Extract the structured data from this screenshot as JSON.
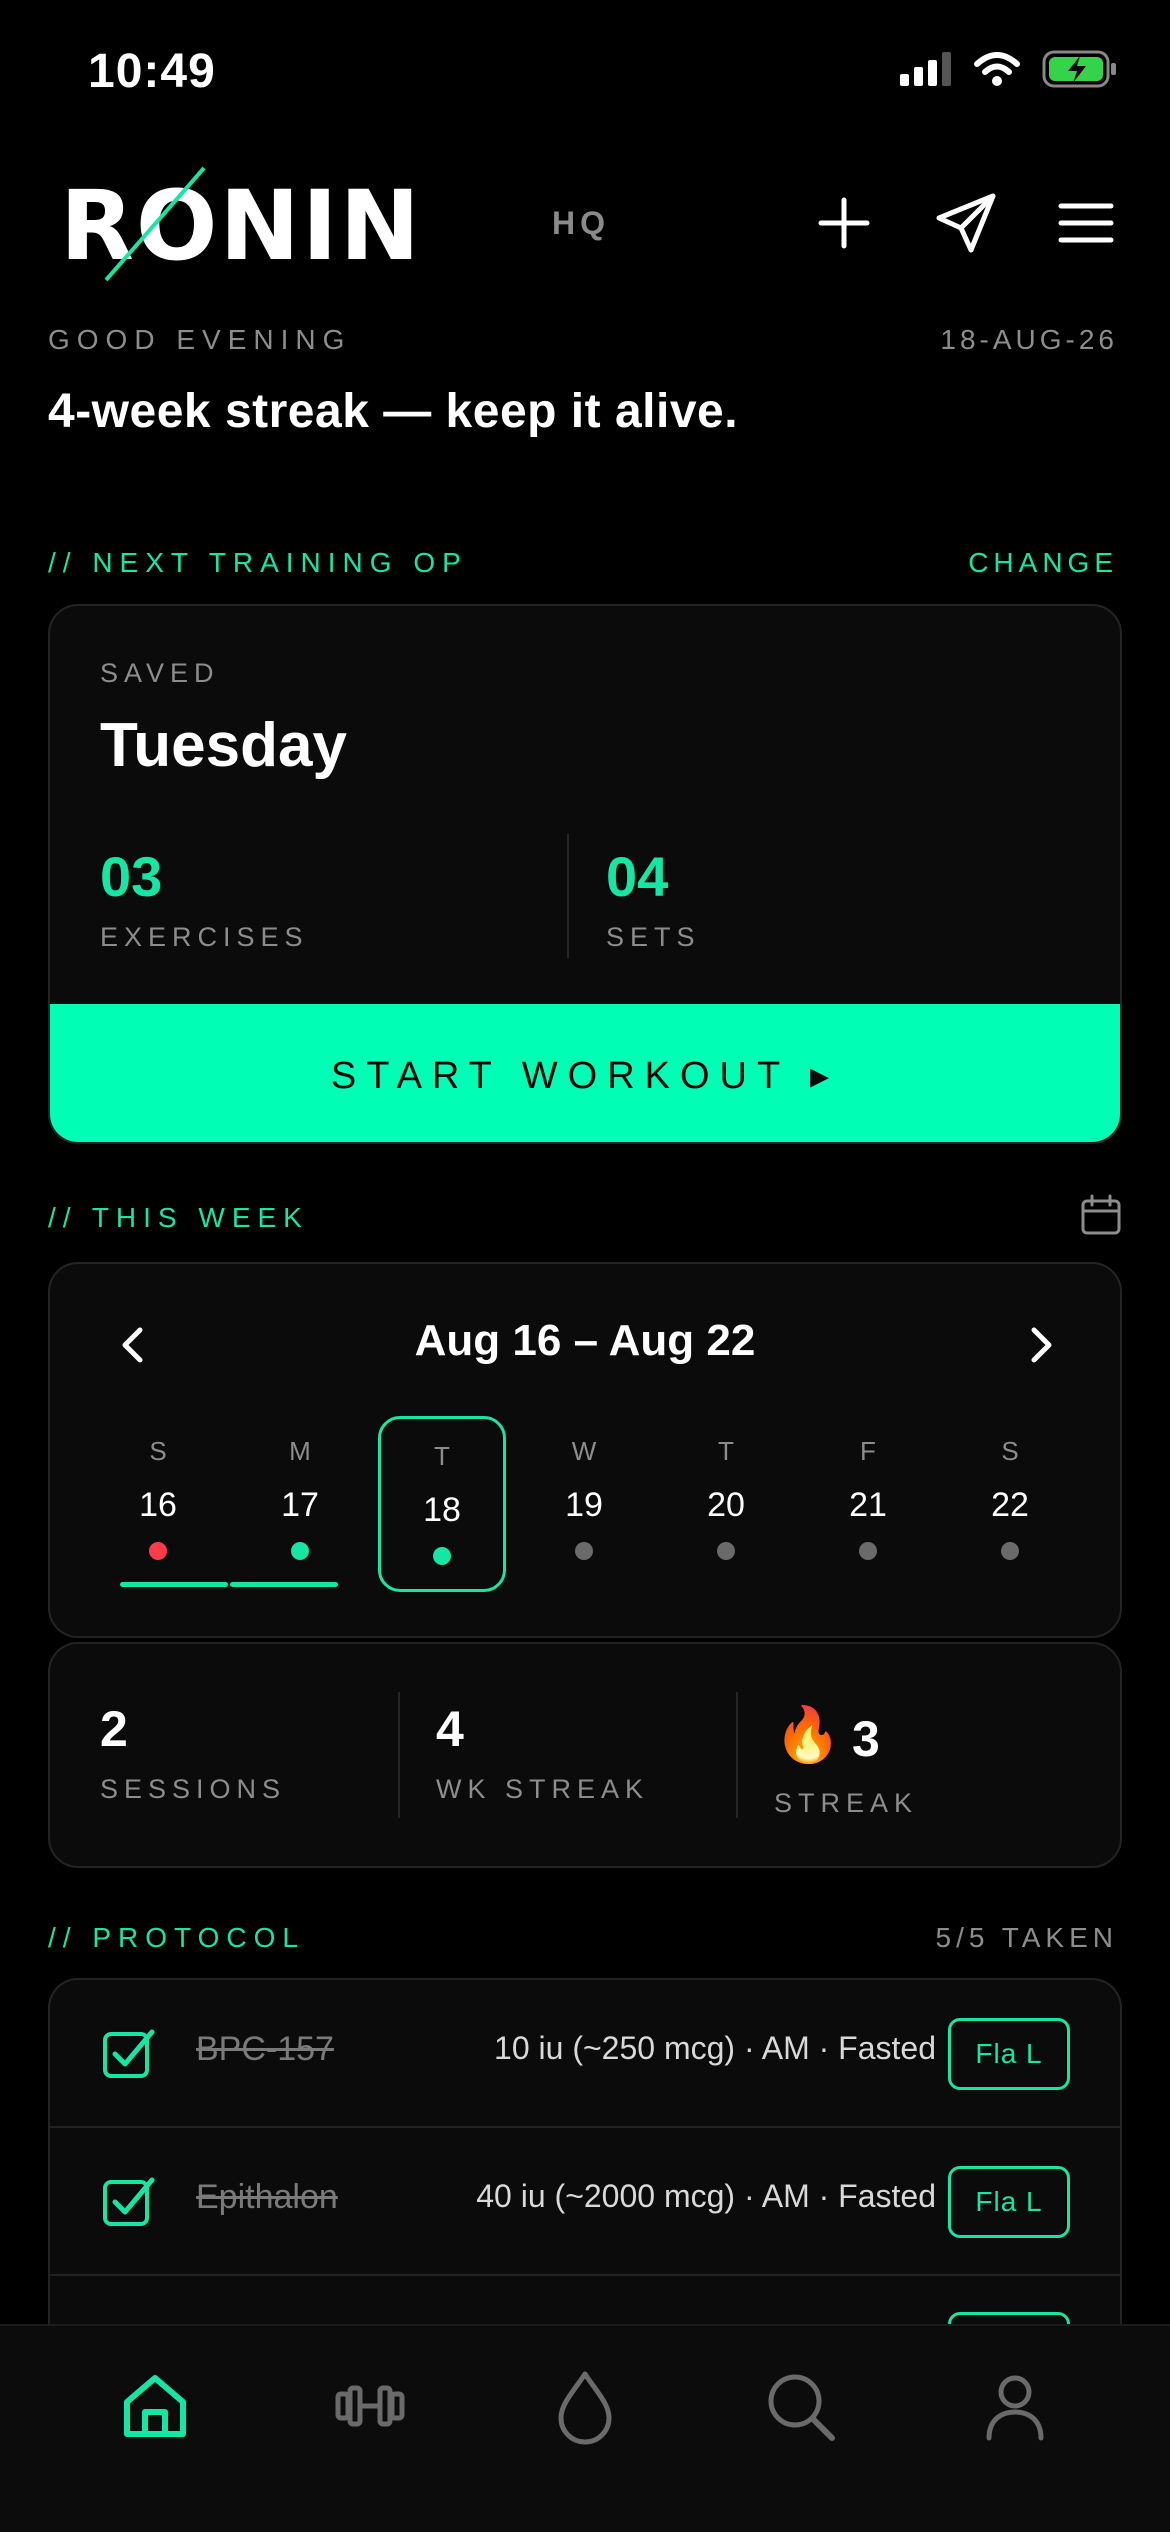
{
  "status": {
    "time": "10:49"
  },
  "header": {
    "logo": "RONIN",
    "center_label": "HQ",
    "icons": [
      "plus-icon",
      "send-icon",
      "menu-icon"
    ]
  },
  "greeting": {
    "label": "GOOD EVENING",
    "date": "18-AUG-26",
    "headline": "4-week streak — keep it alive."
  },
  "next_training": {
    "section_label": "// NEXT TRAINING OP",
    "action_label": "CHANGE",
    "saved_label": "SAVED",
    "day": "Tuesday",
    "exercises_value": "03",
    "exercises_label": "EXERCISES",
    "sets_value": "04",
    "sets_label": "SETS",
    "start_label": "START WORKOUT ▸"
  },
  "this_week": {
    "section_label": "// THIS WEEK",
    "range": "Aug 16 – Aug 22",
    "days": [
      {
        "letter": "S",
        "num": "16",
        "status": "missed"
      },
      {
        "letter": "M",
        "num": "17",
        "status": "done"
      },
      {
        "letter": "T",
        "num": "18",
        "status": "today"
      },
      {
        "letter": "W",
        "num": "19",
        "status": "upcoming"
      },
      {
        "letter": "T",
        "num": "20",
        "status": "upcoming"
      },
      {
        "letter": "F",
        "num": "21",
        "status": "upcoming"
      },
      {
        "letter": "S",
        "num": "22",
        "status": "upcoming"
      }
    ]
  },
  "summary": {
    "sessions_value": "2",
    "sessions_label": "SESSIONS",
    "wk_streak_value": "4",
    "wk_streak_label": "WK STREAK",
    "streak_icon": "🔥",
    "streak_value": "3",
    "streak_label": "STREAK"
  },
  "protocol": {
    "section_label": "// PROTOCOL",
    "taken_label": "5/5 TAKEN",
    "items": [
      {
        "name": "BPC-157",
        "dose": "10 iu (~250 mcg) · AM · Fasted",
        "tag": "Fla L",
        "checked": true
      },
      {
        "name": "Epithalon",
        "dose": "40 iu (~2000 mcg) · AM · Fasted",
        "tag": "Fla L",
        "checked": true
      }
    ]
  },
  "colors": {
    "accent": "#14e6a3",
    "button": "#00ffb5",
    "missed": "#ff3b4a",
    "upcoming": "#6a6a6a"
  },
  "tabbar": {
    "items": [
      "home-icon",
      "dumbbell-icon",
      "drop-icon",
      "search-icon",
      "profile-icon"
    ],
    "active": "home-icon"
  }
}
